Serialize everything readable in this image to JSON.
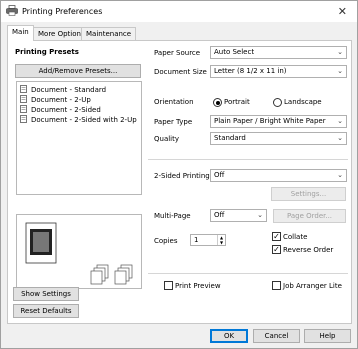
{
  "window": {
    "title": "Printing Preferences"
  },
  "tabs": [
    {
      "label": "Main"
    },
    {
      "label": "More Options"
    },
    {
      "label": "Maintenance"
    }
  ],
  "presets": {
    "heading": "Printing Presets",
    "add_remove_label": "Add/Remove Presets...",
    "items": [
      "Document - Standard",
      "Document - 2-Up",
      "Document - 2-Sided",
      "Document - 2-Sided with 2-Up"
    ]
  },
  "settings": {
    "paper_source": {
      "label": "Paper Source",
      "value": "Auto Select"
    },
    "document_size": {
      "label": "Document Size",
      "value": "Letter (8 1/2 x 11 in)"
    },
    "orientation": {
      "label": "Orientation",
      "portrait": "Portrait",
      "landscape": "Landscape",
      "selected": "Portrait"
    },
    "paper_type": {
      "label": "Paper Type",
      "value": "Plain Paper / Bright White Paper"
    },
    "quality": {
      "label": "Quality",
      "value": "Standard"
    },
    "two_sided": {
      "label": "2-Sided Printing",
      "value": "Off",
      "settings_button": "Settings..."
    },
    "multi_page": {
      "label": "Multi-Page",
      "value": "Off",
      "page_order_button": "Page Order..."
    },
    "copies": {
      "label": "Copies",
      "value": "1"
    },
    "collate": {
      "label": "Collate",
      "checked": true
    },
    "reverse_order": {
      "label": "Reverse Order",
      "checked": true
    },
    "print_preview": {
      "label": "Print Preview",
      "checked": false
    },
    "job_arranger": {
      "label": "Job Arranger Lite",
      "checked": false
    }
  },
  "left_buttons": {
    "show_settings": "Show Settings",
    "reset_defaults": "Reset Defaults"
  },
  "footer": {
    "ok": "OK",
    "cancel": "Cancel",
    "help": "Help"
  },
  "icons": {
    "app": "printer-icon",
    "close": "close-icon",
    "preset_doc": "document-icon"
  },
  "colors": {
    "accent": "#0078d7"
  }
}
